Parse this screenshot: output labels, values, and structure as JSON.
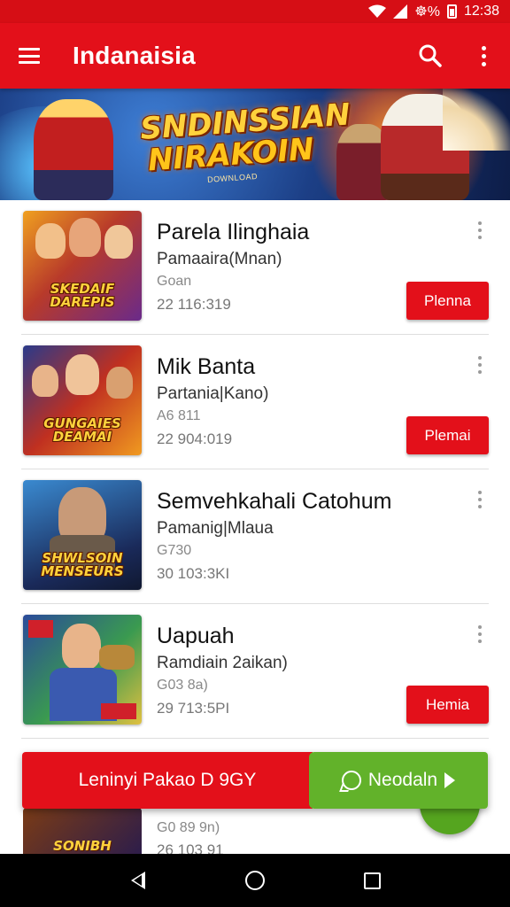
{
  "status_bar": {
    "time": "12:38",
    "battery_label": "☸%",
    "icons": [
      "wifi-icon",
      "signal-icon",
      "battery-icon"
    ]
  },
  "app_bar": {
    "title": "Indanaisia",
    "icons": [
      "menu-icon",
      "search-icon",
      "more-vert-icon"
    ]
  },
  "banner": {
    "line1": "SNDINSSIAN",
    "line2": "NIRAKOIN",
    "subtitle": "DOWNLOAD"
  },
  "games": [
    {
      "title": "Parela Ilinghaia",
      "subtitle": "Pamaaira(Mnan)",
      "meta": "Goan",
      "date": "22 116:319",
      "thumb_label": "SKEDAIF DAREPIS",
      "button": "Plenna",
      "colors": [
        "#f0a020",
        "#6a2a8a"
      ]
    },
    {
      "title": "Mik Banta",
      "subtitle": "Partania|Kano)",
      "meta": "A6 811",
      "date": "22 904:019",
      "thumb_label": "GUNGAIES DEAMAI",
      "button": "Plemai",
      "colors": [
        "#c03020",
        "#2a3a8a"
      ]
    },
    {
      "title": "Semvehkahali Catohum",
      "subtitle": "Pamanig|Mlaua",
      "meta": "G730",
      "date": "30 103:3KI",
      "thumb_label": "SHWLSOIN MENSEURS",
      "button": "",
      "colors": [
        "#2a6ab0",
        "#1a2a5a"
      ]
    },
    {
      "title": "Uapuah",
      "subtitle": "Ramdiain 2aikan)",
      "meta": "G03 8a)",
      "date": "29 713:5PI",
      "thumb_label": "",
      "button": "Hemia",
      "colors": [
        "#3a9a50",
        "#2a4a9a"
      ]
    }
  ],
  "partial_item": {
    "thumb_label": "SONIBH",
    "meta": "G0 89 9n)",
    "date": "26 103 91"
  },
  "action_bar": {
    "primary_label": "Leninyi Pakao D 9GY",
    "secondary_label": "Neodaln",
    "primary_color": "#e3101a",
    "secondary_color": "#62b22a"
  },
  "nav_bar": {
    "icons": [
      "back-icon",
      "home-icon",
      "recents-icon"
    ]
  }
}
